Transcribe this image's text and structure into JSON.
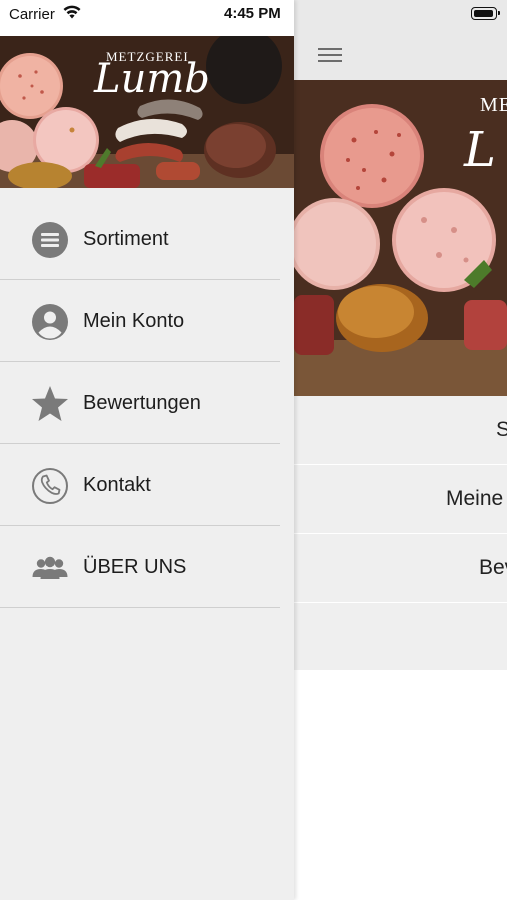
{
  "status_bar": {
    "carrier": "Carrier",
    "time": "4:45 PM"
  },
  "brand": {
    "line1": "METZGEREI",
    "line2": "Lumb"
  },
  "drawer": {
    "items": [
      {
        "label": "Sortiment",
        "icon": "list-icon"
      },
      {
        "label": "Mein Konto",
        "icon": "account-icon"
      },
      {
        "label": "Bewertungen",
        "icon": "star-icon"
      },
      {
        "label": "Kontakt",
        "icon": "phone-icon"
      },
      {
        "label": "ÜBER UNS",
        "icon": "group-icon"
      }
    ]
  },
  "main": {
    "brand_partial_line1": "ME",
    "brand_partial_line2": "L",
    "rows": [
      {
        "label": "S"
      },
      {
        "label": "Meine"
      },
      {
        "label": "Bev"
      }
    ]
  },
  "colors": {
    "drawer_background": "#efefef",
    "icon_gray": "#7a7a7a",
    "divider": "#cfcfcf",
    "navbar_background": "#e9e9e9"
  }
}
